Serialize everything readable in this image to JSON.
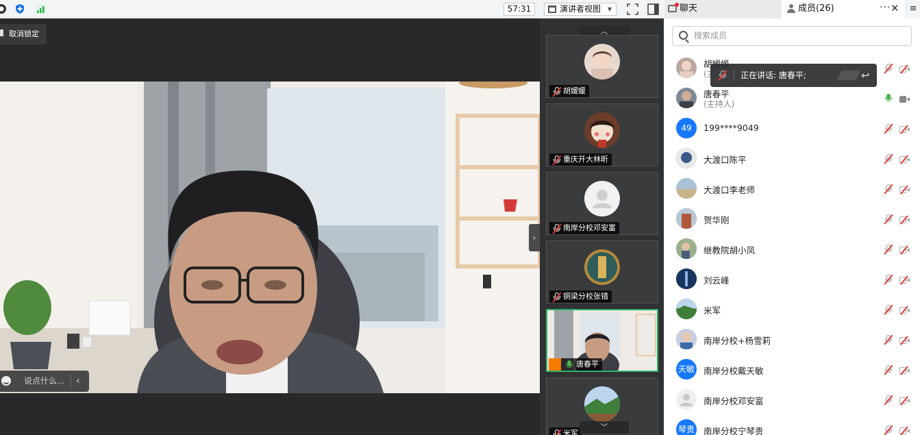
{
  "toolbar": {
    "timer": "57:31",
    "view_mode": "演讲者视图",
    "chat_tab": "聊天",
    "members_tab": "成员(26)",
    "more": "···",
    "close": "✕",
    "menu": "≡",
    "colors": {
      "shield": "#1a73e8",
      "signal": "#2db04b"
    }
  },
  "stage": {
    "unlock_label": "取消锁定",
    "say_placeholder": "说点什么...",
    "collapse": "›"
  },
  "thumbnails": {
    "scroll_up": "︿",
    "scroll_down": "﹀",
    "items": [
      {
        "name": "胡嫒媛",
        "avatar": "photo-child",
        "muted": true
      },
      {
        "name": "重庆开大林昕",
        "avatar": "photo-cartoon",
        "muted": true
      },
      {
        "name": "南岸分校邓安富",
        "avatar": "default-user",
        "muted": true
      },
      {
        "name": "铜梁分校张错",
        "avatar": "photo-calligraphy",
        "muted": true
      },
      {
        "name": "唐春平",
        "avatar": "live-video",
        "muted": false
      },
      {
        "name": "米军",
        "avatar": "photo-landscape",
        "muted": true
      }
    ]
  },
  "panel": {
    "search_placeholder": "搜索成员",
    "speaking": "正在讲话: 唐春平;",
    "members": [
      {
        "name": "胡嫒媛",
        "role": "(主",
        "avatar_text": "",
        "avatar_color": "#b9a7a0",
        "muted": true
      },
      {
        "name": "唐春平",
        "role": "(主持人)",
        "avatar_text": "",
        "avatar_color": "#7f8a96",
        "muted": false
      },
      {
        "name": "199****9049",
        "role": "",
        "avatar_text": "49",
        "avatar_color": "#1677ff",
        "muted": true
      },
      {
        "name": "大渡口陈平",
        "role": "",
        "avatar_text": "",
        "avatar_color": "#5f6f8a",
        "muted": true
      },
      {
        "name": "大渡口李老师",
        "role": "",
        "avatar_text": "",
        "avatar_color": "#8fa5b8",
        "muted": true
      },
      {
        "name": "贺华刚",
        "role": "",
        "avatar_text": "",
        "avatar_color": "#b07a5a",
        "muted": true
      },
      {
        "name": "继教院胡小凤",
        "role": "",
        "avatar_text": "",
        "avatar_color": "#7a8f70",
        "muted": true
      },
      {
        "name": "刘云峰",
        "role": "",
        "avatar_text": "",
        "avatar_color": "#1d3d6a",
        "muted": true
      },
      {
        "name": "米军",
        "role": "",
        "avatar_text": "",
        "avatar_color": "#6f9b5a",
        "muted": true
      },
      {
        "name": "南岸分校+杨雪莉",
        "role": "",
        "avatar_text": "",
        "avatar_color": "#9aa3b5",
        "muted": true
      },
      {
        "name": "南岸分校戴天敏",
        "role": "",
        "avatar_text": "天敏",
        "avatar_color": "#1677ff",
        "muted": true
      },
      {
        "name": "南岸分校邓安富",
        "role": "",
        "avatar_text": "",
        "avatar_color": "#d9d9d9",
        "muted": true
      },
      {
        "name": "南岸分校宁琴贵",
        "role": "",
        "avatar_text": "琴贵",
        "avatar_color": "#1677ff",
        "muted": true
      }
    ]
  }
}
